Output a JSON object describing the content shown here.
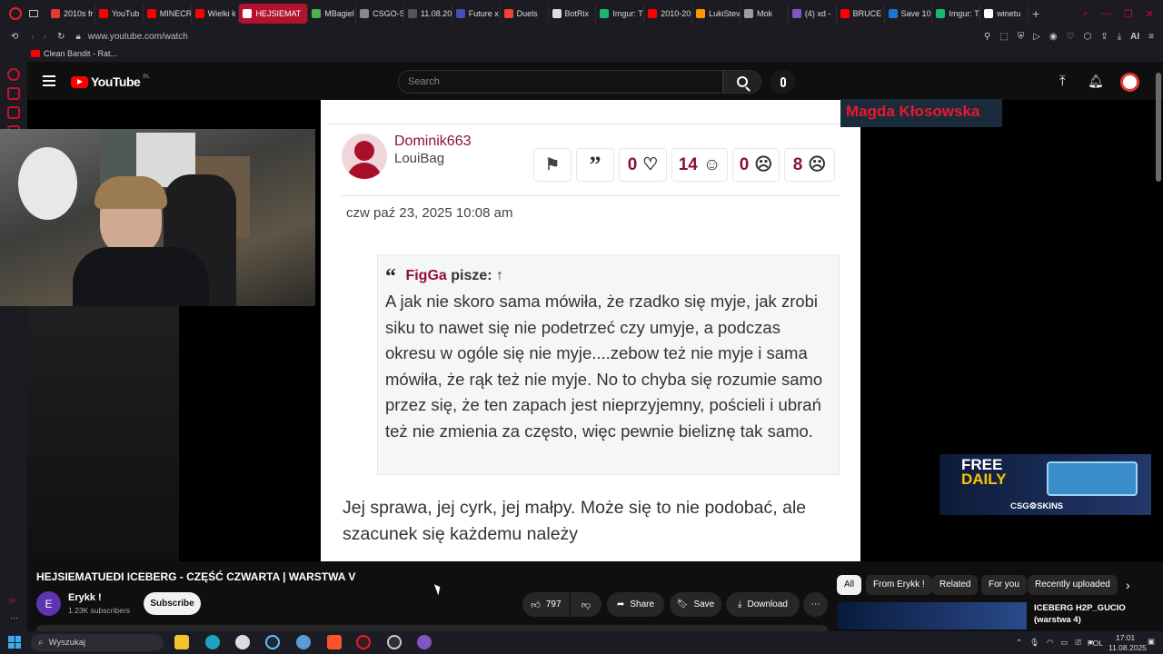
{
  "browser": {
    "tabs": [
      {
        "label": "2010s fr",
        "color": "#e53935"
      },
      {
        "label": "YouTub",
        "color": "#ff0000"
      },
      {
        "label": "MINECR",
        "color": "#ff0000"
      },
      {
        "label": "Wielki k",
        "color": "#ff0000"
      },
      {
        "label": "HEJSIEMAT",
        "color": "#ffffff",
        "active": true
      },
      {
        "label": "MBagiel",
        "color": "#4caf50"
      },
      {
        "label": "CSGO-S",
        "color": "#888888"
      },
      {
        "label": "11.08.20",
        "color": "#555555"
      },
      {
        "label": "Future x",
        "color": "#3f51b5"
      },
      {
        "label": "Duels",
        "color": "#f44336"
      },
      {
        "label": "BotRix",
        "color": "#dddddd"
      },
      {
        "label": "Imgur: T",
        "color": "#1bb76e"
      },
      {
        "label": "2010-20",
        "color": "#ff0000"
      },
      {
        "label": "LukiStev",
        "color": "#ff9800"
      },
      {
        "label": "Mok",
        "color": "#9e9e9e"
      },
      {
        "label": "(4) xd -",
        "color": "#7e57c2"
      },
      {
        "label": "BRUCE",
        "color": "#ff0000"
      },
      {
        "label": "Save 10",
        "color": "#1976d2"
      },
      {
        "label": "Imgur: T",
        "color": "#1bb76e"
      },
      {
        "label": "winetu",
        "color": "#ffffff"
      }
    ],
    "url": "www.youtube.com/watch",
    "bookmark": "Clean Bandit - Rat...",
    "ai_label": "AI"
  },
  "youtube": {
    "logo": "YouTube",
    "region": "PL",
    "search_placeholder": "Search"
  },
  "forum": {
    "username": "Dominik663",
    "rank": "LouiBag",
    "reactions": {
      "like": "0",
      "smile": "14",
      "sad": "0",
      "angry": "8"
    },
    "date": "czw paź 23, 2025 10:08 am",
    "quote_author": "FigGa",
    "quote_suffix": "pisze: ↑",
    "quote_text": "A jak nie skoro sama mówiła, że rzadko się myje, jak zrobi siku to nawet się nie podetrzeć czy umyje, a podczas okresu w ogóle się nie myje....zebow też nie myje i sama mówiła, że rąk też nie myje. No to chyba się rozumie samo przez się, że ten zapach jest nieprzyjemny, pościeli i ubrań też nie zmienia za często, więc pewnie bieliznę tak samo.",
    "reply_text": "Jej sprawa, jej cyrk, jej małpy. Może się to nie podobać, ale szacunek się każdemu należy"
  },
  "overlay": {
    "name_tag": "Magda Kłosowska",
    "ad_line1": "FREE",
    "ad_line2": "DAILY",
    "ad_brand": "CSG⚙SKINS"
  },
  "video": {
    "title": "HEJSIEMATUEDI ICEBERG - CZĘŚĆ CZWARTA | WARSTWA V",
    "channel": "Erykk !",
    "avatar_letter": "E",
    "subscribers": "1.23K subscribers",
    "subscribe": "Subscribe",
    "likes": "797",
    "share": "Share",
    "save": "Save",
    "download": "Download"
  },
  "chips": [
    "All",
    "From Erykk !",
    "Related",
    "For you",
    "Recently uploaded"
  ],
  "suggestion": {
    "title": "ICEBERG H2P_GUCIO (warstwa 4)"
  },
  "taskbar": {
    "search": "Wyszukaj",
    "lang": "POL",
    "time": "17:01",
    "date": "11.08.2025"
  }
}
